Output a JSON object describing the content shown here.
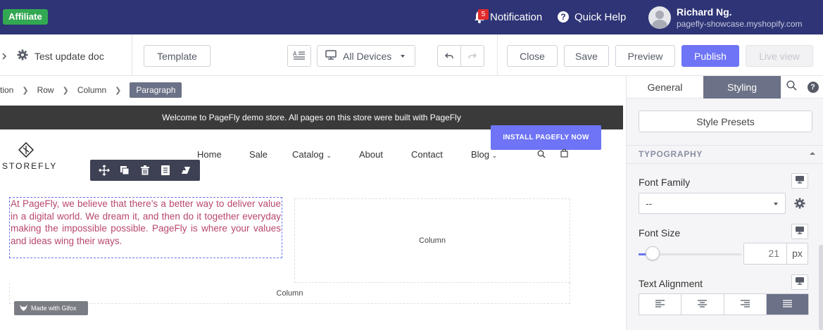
{
  "topbar": {
    "affiliate": "Affiliate",
    "notification_count": "5",
    "notification_label": "Notification",
    "help_label": "Quick Help",
    "user_name": "Richard Ng.",
    "user_shop": "pagefly-showcase.myshopify.com"
  },
  "toolbar": {
    "doc_title": "Test update doc",
    "template": "Template",
    "devices": "All Devices",
    "close": "Close",
    "save": "Save",
    "preview": "Preview",
    "publish": "Publish",
    "liveview": "Live view"
  },
  "breadcrumb": {
    "items": [
      "tion",
      "Row",
      "Column"
    ],
    "active": "Paragraph"
  },
  "canvas": {
    "announcement": "Welcome to PageFly demo store. All pages on this store were built with PageFly",
    "install_button": "INSTALL PAGEFLY NOW",
    "logo_text": "STOREFLY",
    "nav": [
      "Home",
      "Sale",
      "Catalog",
      "About",
      "Contact",
      "Blog"
    ],
    "paragraph": "At PageFly, we believe that there’s a better way to deliver value in a digital world. We dream it, and then do it together everyday making the impossible possible. PageFly is where your values and ideas wing their ways.",
    "column1": "Column",
    "column2": "Column",
    "gifox": "Made with Gifox"
  },
  "panel": {
    "tab_general": "General",
    "tab_styling": "Styling",
    "style_presets": "Style Presets",
    "typography": "TYPOGRAPHY",
    "font_family_label": "Font Family",
    "font_family_value": "--",
    "font_size_label": "Font Size",
    "font_size_value": "21",
    "font_size_unit": "px",
    "font_size_slider_fraction": 0.14,
    "text_alignment_label": "Text Alignment",
    "text_alignment_selected": "justify"
  },
  "colors": {
    "topbar": "#2e3475",
    "accent": "#6e74f5",
    "affiliate": "#32a852",
    "paragraph_text": "#b8476d",
    "styling_tab": "#6b7186"
  }
}
